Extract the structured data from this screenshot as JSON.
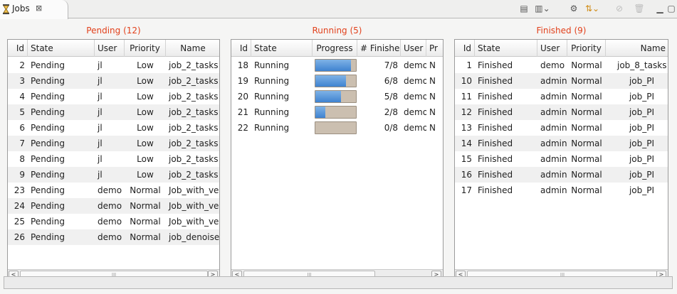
{
  "tab": {
    "title": "Jobs",
    "close": "⊠"
  },
  "toolbar": [
    {
      "name": "view-options-icon",
      "glyph": "▤"
    },
    {
      "name": "layout-menu-icon",
      "glyph": "▥⌄"
    },
    {
      "name": "scheduler-icon",
      "glyph": "⚙"
    },
    {
      "name": "priority-icon",
      "glyph": "⇅⌄"
    },
    {
      "name": "kill-job-icon",
      "glyph": "⊘"
    },
    {
      "name": "delete-icon",
      "glyph": "🗑"
    },
    {
      "name": "minimize-icon",
      "glyph": "▁"
    },
    {
      "name": "maximize-icon",
      "glyph": "▢"
    }
  ],
  "pending": {
    "title": "Pending (12)",
    "columns": [
      "Id",
      "State",
      "User",
      "Priority",
      "Name"
    ],
    "rows": [
      [
        "2",
        "Pending",
        "jl",
        "Low",
        "job_2_tasks"
      ],
      [
        "3",
        "Pending",
        "jl",
        "Low",
        "job_2_tasks"
      ],
      [
        "4",
        "Pending",
        "jl",
        "Low",
        "job_2_tasks"
      ],
      [
        "5",
        "Pending",
        "jl",
        "Low",
        "job_2_tasks"
      ],
      [
        "6",
        "Pending",
        "jl",
        "Low",
        "job_2_tasks"
      ],
      [
        "7",
        "Pending",
        "jl",
        "Low",
        "job_2_tasks"
      ],
      [
        "8",
        "Pending",
        "jl",
        "Low",
        "job_2_tasks"
      ],
      [
        "9",
        "Pending",
        "jl",
        "Low",
        "job_2_tasks"
      ],
      [
        "23",
        "Pending",
        "demo",
        "Normal",
        "Job_with_veri"
      ],
      [
        "24",
        "Pending",
        "demo",
        "Normal",
        "Job_with_veri"
      ],
      [
        "25",
        "Pending",
        "demo",
        "Normal",
        "Job_with_veri"
      ],
      [
        "26",
        "Pending",
        "demo",
        "Normal",
        "job_denoise"
      ]
    ]
  },
  "running": {
    "title": "Running (5)",
    "columns": [
      "Id",
      "State",
      "Progress",
      "# Finishe",
      "User",
      "Pr"
    ],
    "rows": [
      {
        "id": "18",
        "state": "Running",
        "progress": 0.875,
        "finished": "7/8",
        "user": "demo",
        "pr": "N"
      },
      {
        "id": "19",
        "state": "Running",
        "progress": 0.75,
        "finished": "6/8",
        "user": "demo",
        "pr": "N"
      },
      {
        "id": "20",
        "state": "Running",
        "progress": 0.625,
        "finished": "5/8",
        "user": "demo",
        "pr": "N"
      },
      {
        "id": "21",
        "state": "Running",
        "progress": 0.25,
        "finished": "2/8",
        "user": "demo",
        "pr": "N"
      },
      {
        "id": "22",
        "state": "Running",
        "progress": 0.0,
        "finished": "0/8",
        "user": "demo",
        "pr": "N"
      }
    ]
  },
  "finished": {
    "title": "Finished (9)",
    "columns": [
      "Id",
      "State",
      "User",
      "Priority",
      "Name"
    ],
    "rows": [
      [
        "1",
        "Finished",
        "demo",
        "Normal",
        "job_8_tasks"
      ],
      [
        "10",
        "Finished",
        "admin",
        "Normal",
        "job_PI"
      ],
      [
        "11",
        "Finished",
        "admin",
        "Normal",
        "job_PI"
      ],
      [
        "12",
        "Finished",
        "admin",
        "Normal",
        "job_PI"
      ],
      [
        "13",
        "Finished",
        "admin",
        "Normal",
        "job_PI"
      ],
      [
        "14",
        "Finished",
        "admin",
        "Normal",
        "job_PI"
      ],
      [
        "15",
        "Finished",
        "admin",
        "Normal",
        "job_PI"
      ],
      [
        "16",
        "Finished",
        "admin",
        "Normal",
        "job_PI"
      ],
      [
        "17",
        "Finished",
        "admin",
        "Normal",
        "job_PI"
      ]
    ]
  },
  "scroll": {
    "left": "<",
    "right": ">",
    "grip": "III"
  },
  "colors": {
    "title": "#e2411c",
    "progress_fill": "#3f82d0",
    "progress_track": "#cbbfb0"
  }
}
